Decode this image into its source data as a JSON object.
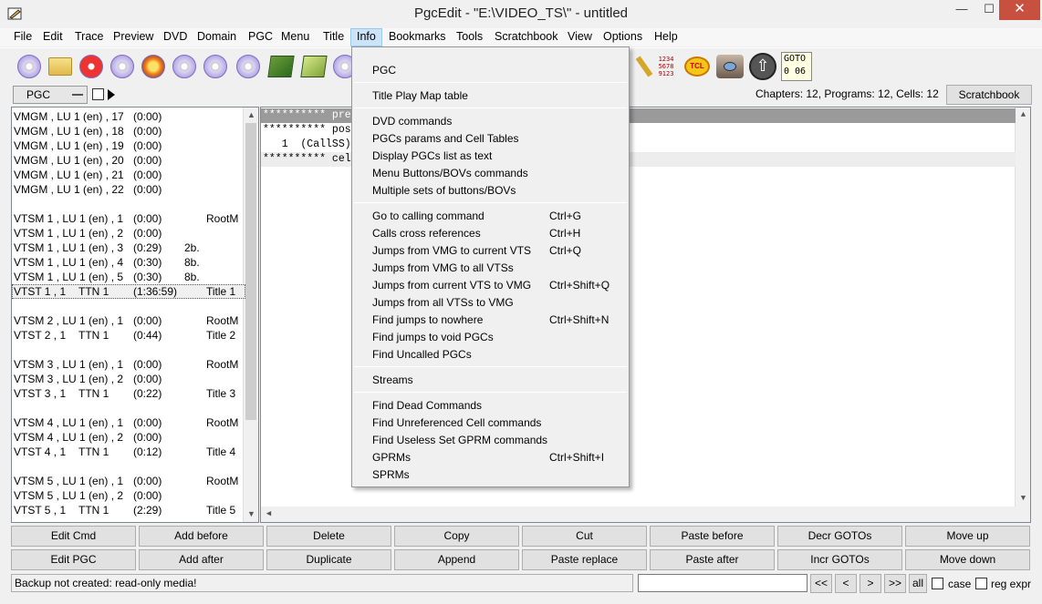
{
  "window": {
    "title": "PgcEdit -   \"E:\\VIDEO_TS\\\" - untitled",
    "minimize": "—",
    "maximize": "☐",
    "close": "✕"
  },
  "menubar": [
    "File",
    "Edit",
    "Trace",
    "Preview",
    "DVD",
    "Domain",
    "PGC",
    "Menu",
    "Title",
    "Info",
    "Bookmarks",
    "Tools",
    "Scratchbook",
    "View",
    "Options",
    "Help"
  ],
  "menubar_active": "Info",
  "toolbar": {
    "goto_label": "GOTO",
    "goto_values": "0 06",
    "numbers_icon_text": "1234\n5678\n9123"
  },
  "pgc_selector": {
    "value": "PGC"
  },
  "stats": "Chapters: 12,  Programs: 12,  Cells: 12",
  "scratchbook_button": "Scratchbook",
  "pgc_list": [
    {
      "a": "VMGM , LU 1 (en) , 17",
      "b": "(0:00)",
      "c": "",
      "d": ""
    },
    {
      "a": "VMGM , LU 1 (en) , 18",
      "b": "(0:00)",
      "c": "",
      "d": ""
    },
    {
      "a": "VMGM , LU 1 (en) , 19",
      "b": "(0:00)",
      "c": "",
      "d": ""
    },
    {
      "a": "VMGM , LU 1 (en) , 20",
      "b": "(0:00)",
      "c": "",
      "d": ""
    },
    {
      "a": "VMGM , LU 1 (en) , 21",
      "b": "(0:00)",
      "c": "",
      "d": ""
    },
    {
      "a": "VMGM , LU 1 (en) , 22",
      "b": "(0:00)",
      "c": "",
      "d": ""
    },
    {
      "a": "",
      "b": "",
      "c": "",
      "d": ""
    },
    {
      "a": "VTSM 1 , LU 1 (en) , 1",
      "b": "(0:00)",
      "c": "",
      "d": "RootM"
    },
    {
      "a": "VTSM 1 , LU 1 (en) , 2",
      "b": "(0:00)",
      "c": "",
      "d": ""
    },
    {
      "a": "VTSM 1 , LU 1 (en) , 3",
      "b": "(0:29)",
      "c": "2b.",
      "d": ""
    },
    {
      "a": "VTSM 1 , LU 1 (en) , 4",
      "b": "(0:30)",
      "c": "8b.",
      "d": ""
    },
    {
      "a": "VTSM 1 , LU 1 (en) , 5",
      "b": "(0:30)",
      "c": "8b.",
      "d": ""
    },
    {
      "a": "VTST 1 , 1",
      "t": "TTN 1",
      "b": "(1:36:59)",
      "c": "",
      "d": "Title 1",
      "selected": true
    },
    {
      "a": "",
      "b": "",
      "c": "",
      "d": ""
    },
    {
      "a": "VTSM 2 , LU 1 (en) , 1",
      "b": "(0:00)",
      "c": "",
      "d": "RootM"
    },
    {
      "a": "VTST 2 , 1",
      "t": "TTN 1",
      "b": "(0:44)",
      "c": "",
      "d": "Title 2"
    },
    {
      "a": "",
      "b": "",
      "c": "",
      "d": ""
    },
    {
      "a": "VTSM 3 , LU 1 (en) , 1",
      "b": "(0:00)",
      "c": "",
      "d": "RootM"
    },
    {
      "a": "VTSM 3 , LU 1 (en) , 2",
      "b": "(0:00)",
      "c": "",
      "d": ""
    },
    {
      "a": "VTST 3 , 1",
      "t": "TTN 1",
      "b": "(0:22)",
      "c": "",
      "d": "Title 3"
    },
    {
      "a": "",
      "b": "",
      "c": "",
      "d": ""
    },
    {
      "a": "VTSM 4 , LU 1 (en) , 1",
      "b": "(0:00)",
      "c": "",
      "d": "RootM"
    },
    {
      "a": "VTSM 4 , LU 1 (en) , 2",
      "b": "(0:00)",
      "c": "",
      "d": ""
    },
    {
      "a": "VTST 4 , 1",
      "t": "TTN 1",
      "b": "(0:12)",
      "c": "",
      "d": "Title 4"
    },
    {
      "a": "",
      "b": "",
      "c": "",
      "d": ""
    },
    {
      "a": "VTSM 5 , LU 1 (en) , 1",
      "b": "(0:00)",
      "c": "",
      "d": "RootM"
    },
    {
      "a": "VTSM 5 , LU 1 (en) , 2",
      "b": "(0:00)",
      "c": "",
      "d": ""
    },
    {
      "a": "VTST 5 , 1",
      "t": "TTN 1",
      "b": "(2:29)",
      "c": "",
      "d": "Title 5"
    }
  ],
  "text_lines": [
    {
      "text": "********** pre",
      "style": "hl"
    },
    {
      "text": "********** pos",
      "style": ""
    },
    {
      "text": "   1  (CallSS)",
      "style": ""
    },
    {
      "text": "********** cel",
      "style": "sh"
    }
  ],
  "info_menu": [
    {
      "label": "PGC",
      "shortcut": ""
    },
    {
      "sep": true
    },
    {
      "label": "Title Play Map table",
      "shortcut": ""
    },
    {
      "sep": true
    },
    {
      "label": "DVD commands",
      "shortcut": ""
    },
    {
      "label": "PGCs params and Cell Tables",
      "shortcut": ""
    },
    {
      "label": "Display PGCs list as text",
      "shortcut": ""
    },
    {
      "label": "Menu Buttons/BOVs commands",
      "shortcut": ""
    },
    {
      "label": "Multiple sets of buttons/BOVs",
      "shortcut": ""
    },
    {
      "sep": true
    },
    {
      "label": "Go to calling command",
      "shortcut": "Ctrl+G"
    },
    {
      "label": "Calls cross references",
      "shortcut": "Ctrl+H"
    },
    {
      "label": "Jumps from VMG to current VTS",
      "shortcut": "Ctrl+Q"
    },
    {
      "label": "Jumps from VMG to all VTSs",
      "shortcut": ""
    },
    {
      "label": "Jumps from current VTS to VMG",
      "shortcut": "Ctrl+Shift+Q"
    },
    {
      "label": "Jumps from all VTSs to VMG",
      "shortcut": ""
    },
    {
      "label": "Find jumps to nowhere",
      "shortcut": "Ctrl+Shift+N"
    },
    {
      "label": "Find jumps to void PGCs",
      "shortcut": ""
    },
    {
      "label": "Find Uncalled PGCs",
      "shortcut": ""
    },
    {
      "sep": true
    },
    {
      "label": "Streams",
      "shortcut": ""
    },
    {
      "sep": true
    },
    {
      "label": "Find Dead Commands",
      "shortcut": ""
    },
    {
      "label": "Find Unreferenced Cell commands",
      "shortcut": ""
    },
    {
      "label": "Find Useless Set GPRM commands",
      "shortcut": ""
    },
    {
      "label": "GPRMs",
      "shortcut": "Ctrl+Shift+I"
    },
    {
      "label": "SPRMs",
      "shortcut": ""
    }
  ],
  "buttons_row1": [
    "Edit Cmd",
    "Add before",
    "Delete",
    "Copy",
    "Cut",
    "Paste before",
    "Decr GOTOs",
    "Move up"
  ],
  "buttons_row2": [
    "Edit PGC",
    "Add after",
    "Duplicate",
    "Append",
    "Paste replace",
    "Paste after",
    "Incr GOTOs",
    "Move down"
  ],
  "status_text": "Backup not created: read-only media!",
  "search": {
    "value": ""
  },
  "nav_buttons": [
    "<<",
    "<",
    ">",
    ">>",
    "all"
  ],
  "case_label": "case",
  "regexpr_label": "reg expr"
}
